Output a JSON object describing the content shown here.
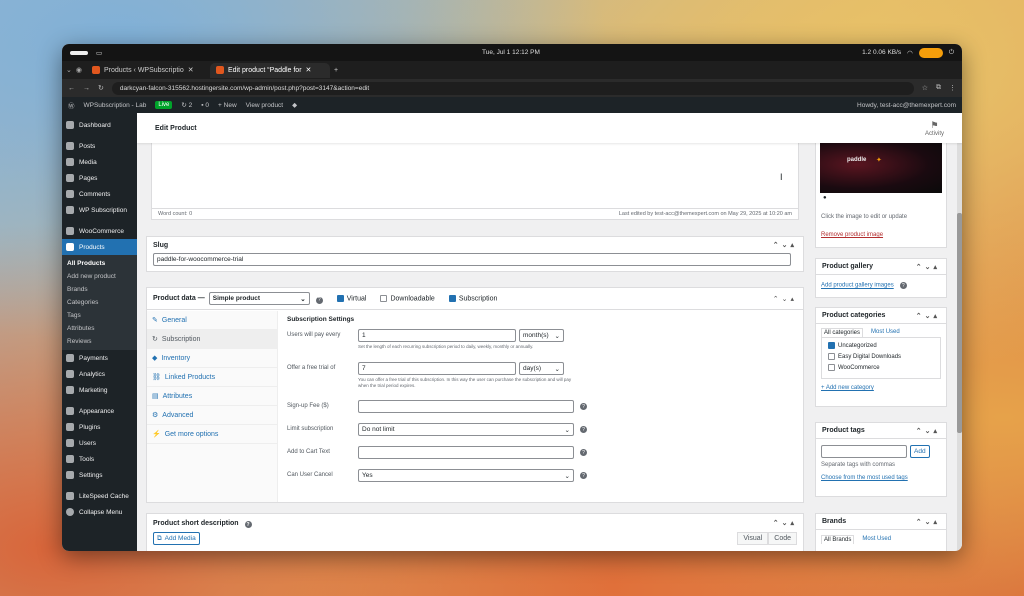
{
  "system": {
    "time": "Tue, Jul 1    12:12 PM",
    "net": "1.2 0.06 KB/s"
  },
  "browser": {
    "tabs": [
      {
        "label": "Products ‹ WPSubscriptio",
        "active": false
      },
      {
        "label": "Edit product “Paddle for",
        "active": true
      }
    ],
    "url": "darkcyan-falcon-315562.hostingersite.com/wp-admin/post.php?post=3147&action=edit"
  },
  "adminbar": {
    "site": "WPSubscription - Lab",
    "live": "Live",
    "updates": "2",
    "comments": "0",
    "new": "New",
    "view": "View product",
    "howdy": "Howdy, test-acc@themexpert.com"
  },
  "sidebar": {
    "items": [
      {
        "label": "Dashboard"
      },
      {
        "label": "Posts"
      },
      {
        "label": "Media"
      },
      {
        "label": "Pages"
      },
      {
        "label": "Comments"
      },
      {
        "label": "WP Subscription"
      },
      {
        "label": "WooCommerce"
      },
      {
        "label": "Products"
      }
    ],
    "sub": [
      "All Products",
      "Add new product",
      "Brands",
      "Categories",
      "Tags",
      "Attributes",
      "Reviews"
    ],
    "items2": [
      {
        "label": "Payments"
      },
      {
        "label": "Analytics"
      },
      {
        "label": "Marketing"
      },
      {
        "label": "Appearance"
      },
      {
        "label": "Plugins"
      },
      {
        "label": "Users"
      },
      {
        "label": "Tools"
      },
      {
        "label": "Settings"
      },
      {
        "label": "LiteSpeed Cache"
      },
      {
        "label": "Collapse Menu"
      }
    ]
  },
  "header": {
    "title": "Edit Product",
    "activity": "Activity"
  },
  "editor": {
    "wordcount": "Word count: 0",
    "lastedited": "Last edited by test-acc@themexpert.com on May 29, 2025 at 10:20 am"
  },
  "slug": {
    "title": "Slug",
    "value": "paddle-for-woocommerce-trial"
  },
  "productdata": {
    "title": "Product data —",
    "type": "Simple product",
    "virtual": "Virtual",
    "downloadable": "Downloadable",
    "subscription": "Subscription",
    "tabs": [
      "General",
      "Subscription",
      "Inventory",
      "Linked Products",
      "Attributes",
      "Advanced",
      "Get more options"
    ],
    "section": "Subscription Settings",
    "pay_label": "Users will pay every",
    "pay_value": "1",
    "pay_unit": "month(s)",
    "pay_hint": "Set the length of each recurring subscription period to daily, weekly, monthly or annually.",
    "trial_label": "Offer a free trial of",
    "trial_value": "7",
    "trial_unit": "day(s)",
    "trial_hint": "You can offer a free trial of this subscription. In this way the user can purchase the subscription and will pay when the trial period expires.",
    "signup_label": "Sign-up Fee ($)",
    "limit_label": "Limit subscription",
    "limit_value": "Do not limit",
    "cart_label": "Add to Cart Text",
    "cancel_label": "Can User Cancel",
    "cancel_value": "Yes"
  },
  "shortdesc": {
    "title": "Product short description",
    "addmedia": "Add Media",
    "visual": "Visual",
    "code": "Code"
  },
  "image": {
    "hint": "Click the image to edit or update",
    "remove": "Remove product image",
    "brand": "paddle"
  },
  "gallery": {
    "title": "Product gallery",
    "add": "Add product gallery images"
  },
  "categories": {
    "title": "Product categories",
    "tab_all": "All categories",
    "tab_used": "Most Used",
    "items": [
      "Uncategorized",
      "Easy Digital Downloads",
      "WooCommerce"
    ],
    "add": "+ Add new category"
  },
  "tags": {
    "title": "Product tags",
    "add": "Add",
    "hint": "Separate tags with commas",
    "choose": "Choose from the most used tags"
  },
  "brands": {
    "title": "Brands",
    "tab_all": "All Brands",
    "tab_used": "Most Used"
  }
}
